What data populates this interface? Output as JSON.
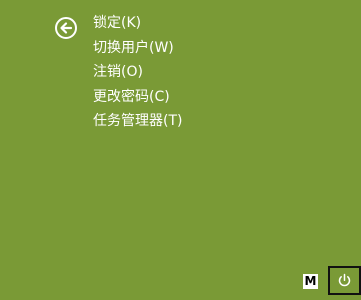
{
  "screen": {
    "background_color": "#7a9a36",
    "foreground_color": "#ffffff"
  },
  "back_button": {
    "icon": "back-arrow-icon"
  },
  "menu": {
    "items": [
      {
        "label": "锁定(K)"
      },
      {
        "label": "切换用户(W)"
      },
      {
        "label": "注销(O)"
      },
      {
        "label": "更改密码(C)"
      },
      {
        "label": "任务管理器(T)"
      }
    ]
  },
  "ime_indicator": {
    "label": "M"
  },
  "power_button": {
    "icon": "power-icon"
  }
}
